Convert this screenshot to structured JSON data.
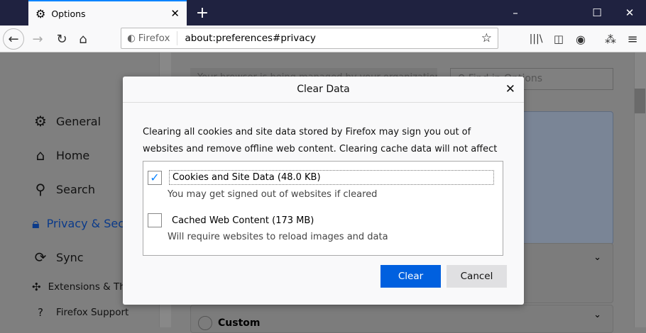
{
  "browser": {
    "tab_title": "Options",
    "url_identity": "Firefox",
    "url": "about:preferences#privacy"
  },
  "sidebar": {
    "items": [
      {
        "label": "General",
        "icon": "gear"
      },
      {
        "label": "Home",
        "icon": "home"
      },
      {
        "label": "Search",
        "icon": "search"
      },
      {
        "label": "Privacy & Security",
        "icon": "lock"
      },
      {
        "label": "Sync",
        "icon": "sync"
      },
      {
        "label": "Extensions & Themes",
        "icon": "puzzle"
      },
      {
        "label": "Firefox Support",
        "icon": "help"
      }
    ]
  },
  "main": {
    "managed_notice": "Your browser is being managed by your organization",
    "search_placeholder": "Find in Options",
    "custom_label": "Custom"
  },
  "dialog": {
    "title": "Clear Data",
    "description": "Clearing all cookies and site data stored by Firefox may sign you out of websites and remove offline web content. Clearing cache data will not affect your logins.",
    "options": [
      {
        "label": "Cookies and Site Data (48.0 KB)",
        "sub": "You may get signed out of websites if cleared",
        "checked": true
      },
      {
        "label": "Cached Web Content (173 MB)",
        "sub": "Will require websites to reload images and data",
        "checked": false
      }
    ],
    "clear_label": "Clear",
    "cancel_label": "Cancel"
  },
  "colors": {
    "accent": "#0060df",
    "tabbar": "#1f2240"
  }
}
